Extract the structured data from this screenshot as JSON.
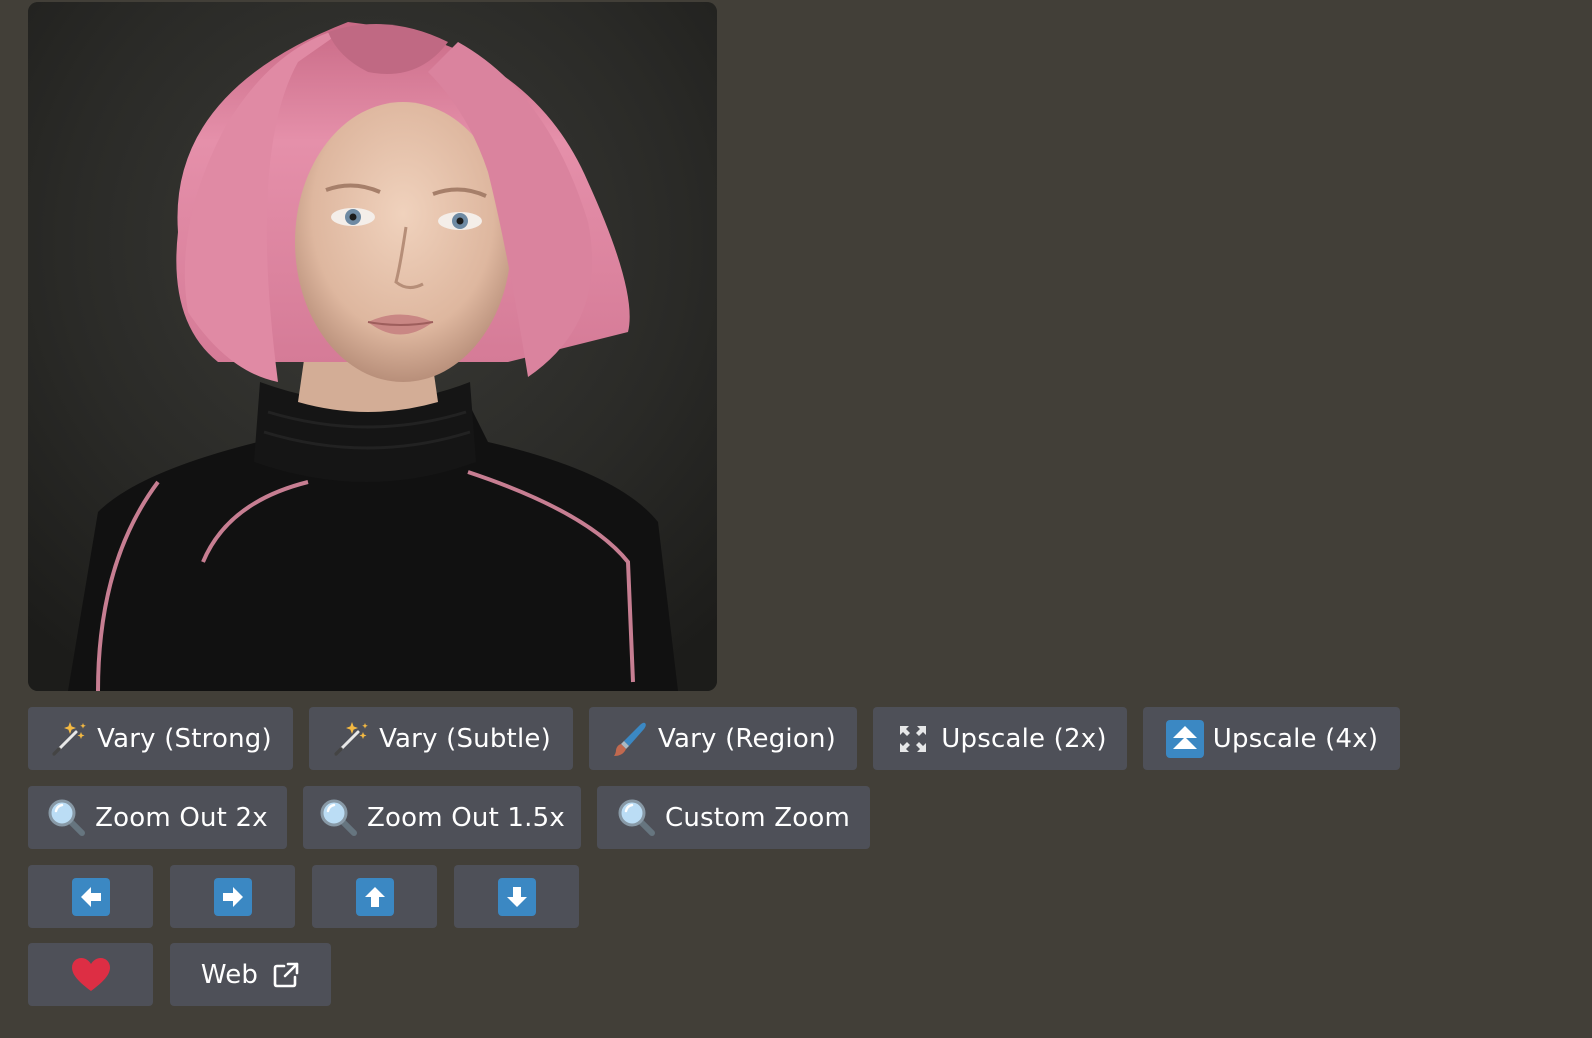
{
  "image": {
    "alt": "",
    "colors": {
      "hair": "#e38aa5",
      "sweater": "#121212",
      "skin": "#e8c4ac",
      "background": "#2b2b28"
    }
  },
  "actions": {
    "vary_strong": {
      "label": "Vary (Strong)",
      "icon": "magic-wand-icon"
    },
    "vary_subtle": {
      "label": "Vary (Subtle)",
      "icon": "magic-wand-icon"
    },
    "vary_region": {
      "label": "Vary (Region)",
      "icon": "paintbrush-icon"
    },
    "upscale_2x": {
      "label": "Upscale (2x)",
      "icon": "expand-arrows-icon"
    },
    "upscale_4x": {
      "label": "Upscale (4x)",
      "icon": "double-up-arrow-icon"
    }
  },
  "zoom": {
    "out_2x": {
      "label": "Zoom Out 2x",
      "icon": "magnifier-icon"
    },
    "out_15x": {
      "label": "Zoom Out 1.5x",
      "icon": "magnifier-icon"
    },
    "custom": {
      "label": "Custom Zoom",
      "icon": "magnifier-icon"
    }
  },
  "pan": [
    {
      "direction": "left",
      "icon": "arrow-left-icon"
    },
    {
      "direction": "right",
      "icon": "arrow-right-icon"
    },
    {
      "direction": "up",
      "icon": "arrow-up-icon"
    },
    {
      "direction": "down",
      "icon": "arrow-down-icon"
    }
  ],
  "misc": {
    "favorite_icon": "heart-icon",
    "web": {
      "label": "Web",
      "icon": "external-link-icon"
    }
  },
  "colors": {
    "page_bg": "#423f38",
    "button_bg": "#4e5058",
    "button_text": "#ffffff",
    "arrow_blue": "#3b88c3",
    "heart_red": "#dd2e44"
  }
}
